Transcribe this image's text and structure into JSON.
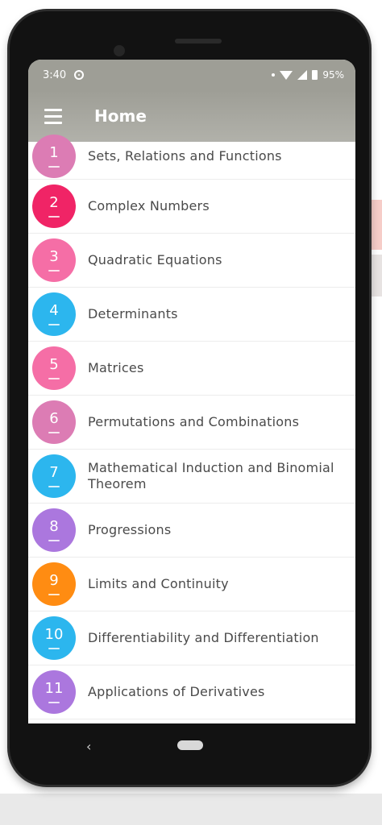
{
  "status_bar": {
    "time": "3:40",
    "battery": "95%",
    "icons": [
      "gps-icon",
      "dot-icon",
      "wifi-icon",
      "signal-icon",
      "battery-icon"
    ]
  },
  "app_bar": {
    "title": "Home",
    "menu_icon": "hamburger-menu-icon",
    "background": "#9e9e96"
  },
  "chapters": [
    {
      "number": "1",
      "title": "Sets, Relations and Functions",
      "color": "#dc7cb4"
    },
    {
      "number": "2",
      "title": "Complex Numbers",
      "color": "#f02466"
    },
    {
      "number": "3",
      "title": "Quadratic Equations",
      "color": "#f56ea6"
    },
    {
      "number": "4",
      "title": "Determinants",
      "color": "#2cb6ee"
    },
    {
      "number": "5",
      "title": "Matrices",
      "color": "#f56ea6"
    },
    {
      "number": "6",
      "title": "Permutations and Combinations",
      "color": "#dc7cb4"
    },
    {
      "number": "7",
      "title": "Mathematical Induction and Binomial Theorem",
      "color": "#2cb6ee"
    },
    {
      "number": "8",
      "title": "Progressions",
      "color": "#ab77de"
    },
    {
      "number": "9",
      "title": "Limits and Continuity",
      "color": "#ff8c12"
    },
    {
      "number": "10",
      "title": "Differentiability and Differentiation",
      "color": "#2cb6ee"
    },
    {
      "number": "11",
      "title": "Applications of Derivatives",
      "color": "#ab77de"
    }
  ],
  "nav_bar": {
    "back_icon": "back-triangle-icon",
    "home_icon": "home-pill-icon"
  }
}
